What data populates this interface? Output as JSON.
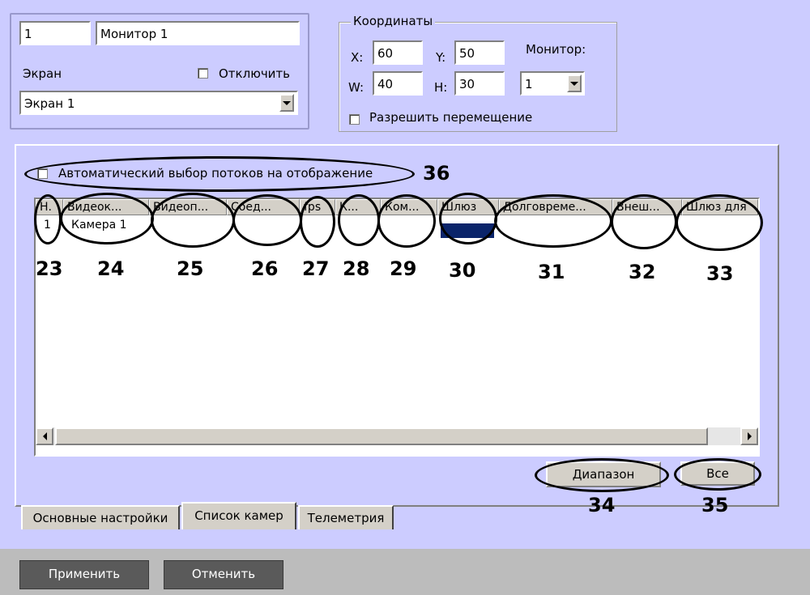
{
  "monitor": {
    "id": "1",
    "name": "Монитор 1",
    "screen_label": "Экран",
    "disable_label": "Отключить",
    "screen_value": "Экран 1"
  },
  "coords": {
    "title": "Координаты",
    "x_label": "X:",
    "x": "60",
    "y_label": "Y:",
    "y": "50",
    "w_label": "W:",
    "w": "40",
    "h_label": "H:",
    "h": "30",
    "monitor_label": "Монитор:",
    "monitor_value": "1",
    "allow_move_label": "Разрешить перемещение"
  },
  "cameras": {
    "auto_select_label": "Автоматический выбор потоков на отображение",
    "columns": [
      "Н.",
      "Видеок...",
      "Видеоп...",
      "Соед...",
      "fps",
      "К...",
      "Ком...",
      "Шлюз",
      "Долговреме...",
      "Внеш...",
      "Шлюз для"
    ],
    "rows": [
      [
        "1",
        "Камера 1",
        "",
        "",
        "",
        "",
        "",
        "",
        "",
        "",
        ""
      ]
    ],
    "range_button": "Диапазон",
    "all_button": "Все"
  },
  "annotations": {
    "n23": "23",
    "n24": "24",
    "n25": "25",
    "n26": "26",
    "n27": "27",
    "n28": "28",
    "n29": "29",
    "n30": "30",
    "n31": "31",
    "n32": "32",
    "n33": "33",
    "n34": "34",
    "n35": "35",
    "n36": "36"
  },
  "tabs": [
    "Основные настройки",
    "Список камер",
    "Телеметрия"
  ],
  "footer": {
    "apply": "Применить",
    "cancel": "Отменить"
  },
  "colors": {
    "lavender": "#ccccff",
    "panel": "#d4d0c8",
    "selection": "#0a246a"
  }
}
